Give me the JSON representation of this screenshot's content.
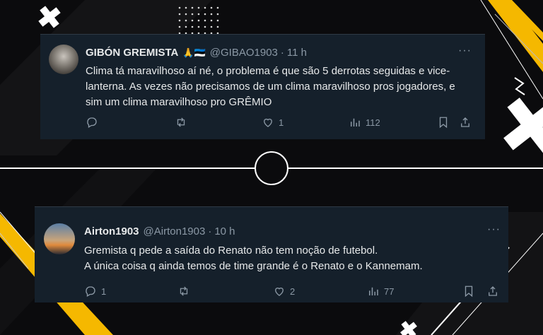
{
  "tweets": [
    {
      "name": "GIBÓN GREMISTA",
      "emoji": "🙏🇪🇪",
      "handle": "@GIBAO1903",
      "time": "11 h",
      "lines": [
        "Clima tá maravilhoso aí né, o problema é que são 5 derrotas seguidas e vice-",
        "lanterna. As vezes não precisamos de um clima maravilhoso pros jogadores, e",
        "sim um clima maravilhoso pro GRÊMIO"
      ],
      "replies": "",
      "retweets": "",
      "likes": "1",
      "views": "112"
    },
    {
      "name": "Airton1903",
      "handle": "@Airton1903",
      "time": "10 h",
      "lines": [
        "Gremista q pede a saída do Renato não tem noção de futebol.",
        "A única coisa q ainda temos de time grande é o Renato e o Kannemam."
      ],
      "replies": "1",
      "retweets": "",
      "likes": "2",
      "views": "77"
    }
  ],
  "ui": {
    "dot": "·",
    "more": "···"
  },
  "colors": {
    "background": "#0b0b0d",
    "card": "#15202b",
    "text": "#e7e9ea",
    "muted": "#8b98a5",
    "accent_yellow": "#f5b800"
  },
  "icons": [
    "reply-icon",
    "retweet-icon",
    "like-icon",
    "views-icon",
    "bookmark-icon",
    "share-icon",
    "more-icon",
    "plus-icon"
  ]
}
